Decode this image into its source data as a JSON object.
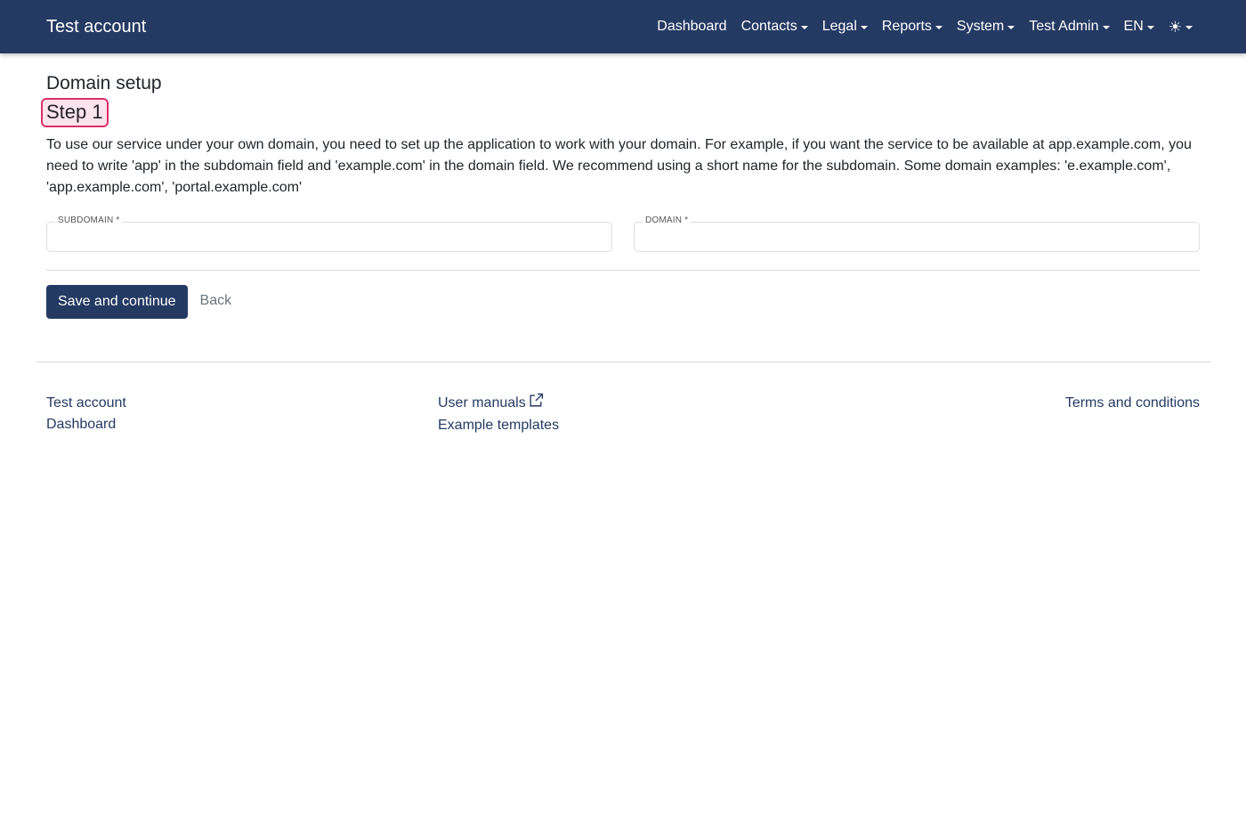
{
  "navbar": {
    "brand": "Test account",
    "items": [
      {
        "label": "Dashboard",
        "dropdown": false
      },
      {
        "label": "Contacts",
        "dropdown": true
      },
      {
        "label": "Legal",
        "dropdown": true
      },
      {
        "label": "Reports",
        "dropdown": true
      },
      {
        "label": "System",
        "dropdown": true
      },
      {
        "label": "Test Admin",
        "dropdown": true
      },
      {
        "label": "EN",
        "dropdown": true
      }
    ],
    "theme_icon": "☀",
    "bg_color": "#253a63"
  },
  "page": {
    "title": "Domain setup",
    "step": "Step 1",
    "description": "To use our service under your own domain, you need to set up the application to work with your domain. For example, if you want the service to be available at app.example.com, you need to write 'app' in the subdomain field and 'example.com' in the domain field. We recommend using a short name for the subdomain. Some domain examples: 'e.example.com', 'app.example.com', 'portal.example.com'"
  },
  "form": {
    "subdomain": {
      "label": "SUBDOMAIN *",
      "value": "",
      "placeholder": ""
    },
    "domain": {
      "label": "DOMAIN *",
      "value": "",
      "placeholder": ""
    }
  },
  "actions": {
    "save_label": "Save and continue",
    "back_label": "Back"
  },
  "footer": {
    "left": [
      "Test account",
      "Dashboard"
    ],
    "mid": [
      "User manuals",
      "Example templates"
    ],
    "right": [
      "Terms and conditions"
    ]
  },
  "colors": {
    "primary": "#253a63",
    "step_border": "#d9306b",
    "step_bg": "#fde3ec"
  }
}
